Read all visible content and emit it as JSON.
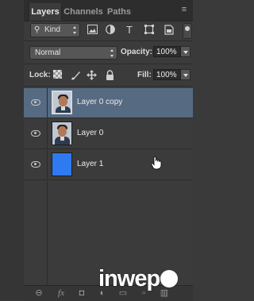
{
  "tabs": [
    {
      "label": "Layers",
      "active": true
    },
    {
      "label": "Channels",
      "active": false
    },
    {
      "label": "Paths",
      "active": false
    }
  ],
  "filter": {
    "kind_label": "Kind",
    "icons": [
      "pixel-filter-icon",
      "adjustment-filter-icon",
      "type-filter-icon",
      "shape-filter-icon",
      "smart-object-filter-icon"
    ]
  },
  "blend": {
    "mode": "Normal",
    "opacity_label": "Opacity:",
    "opacity_value": "100%"
  },
  "lock": {
    "label": "Lock:",
    "fill_label": "Fill:",
    "fill_value": "100%"
  },
  "layers": [
    {
      "name": "Layer 0 copy",
      "thumb": "photo",
      "selected": true
    },
    {
      "name": "Layer 0",
      "thumb": "photo",
      "selected": false
    },
    {
      "name": "Layer 1",
      "thumb": "blue",
      "selected": false
    }
  ],
  "colors": {
    "selected_row": "#566a82",
    "layer1_fill": "#2f7af0"
  },
  "watermark": {
    "text": "inwep"
  }
}
